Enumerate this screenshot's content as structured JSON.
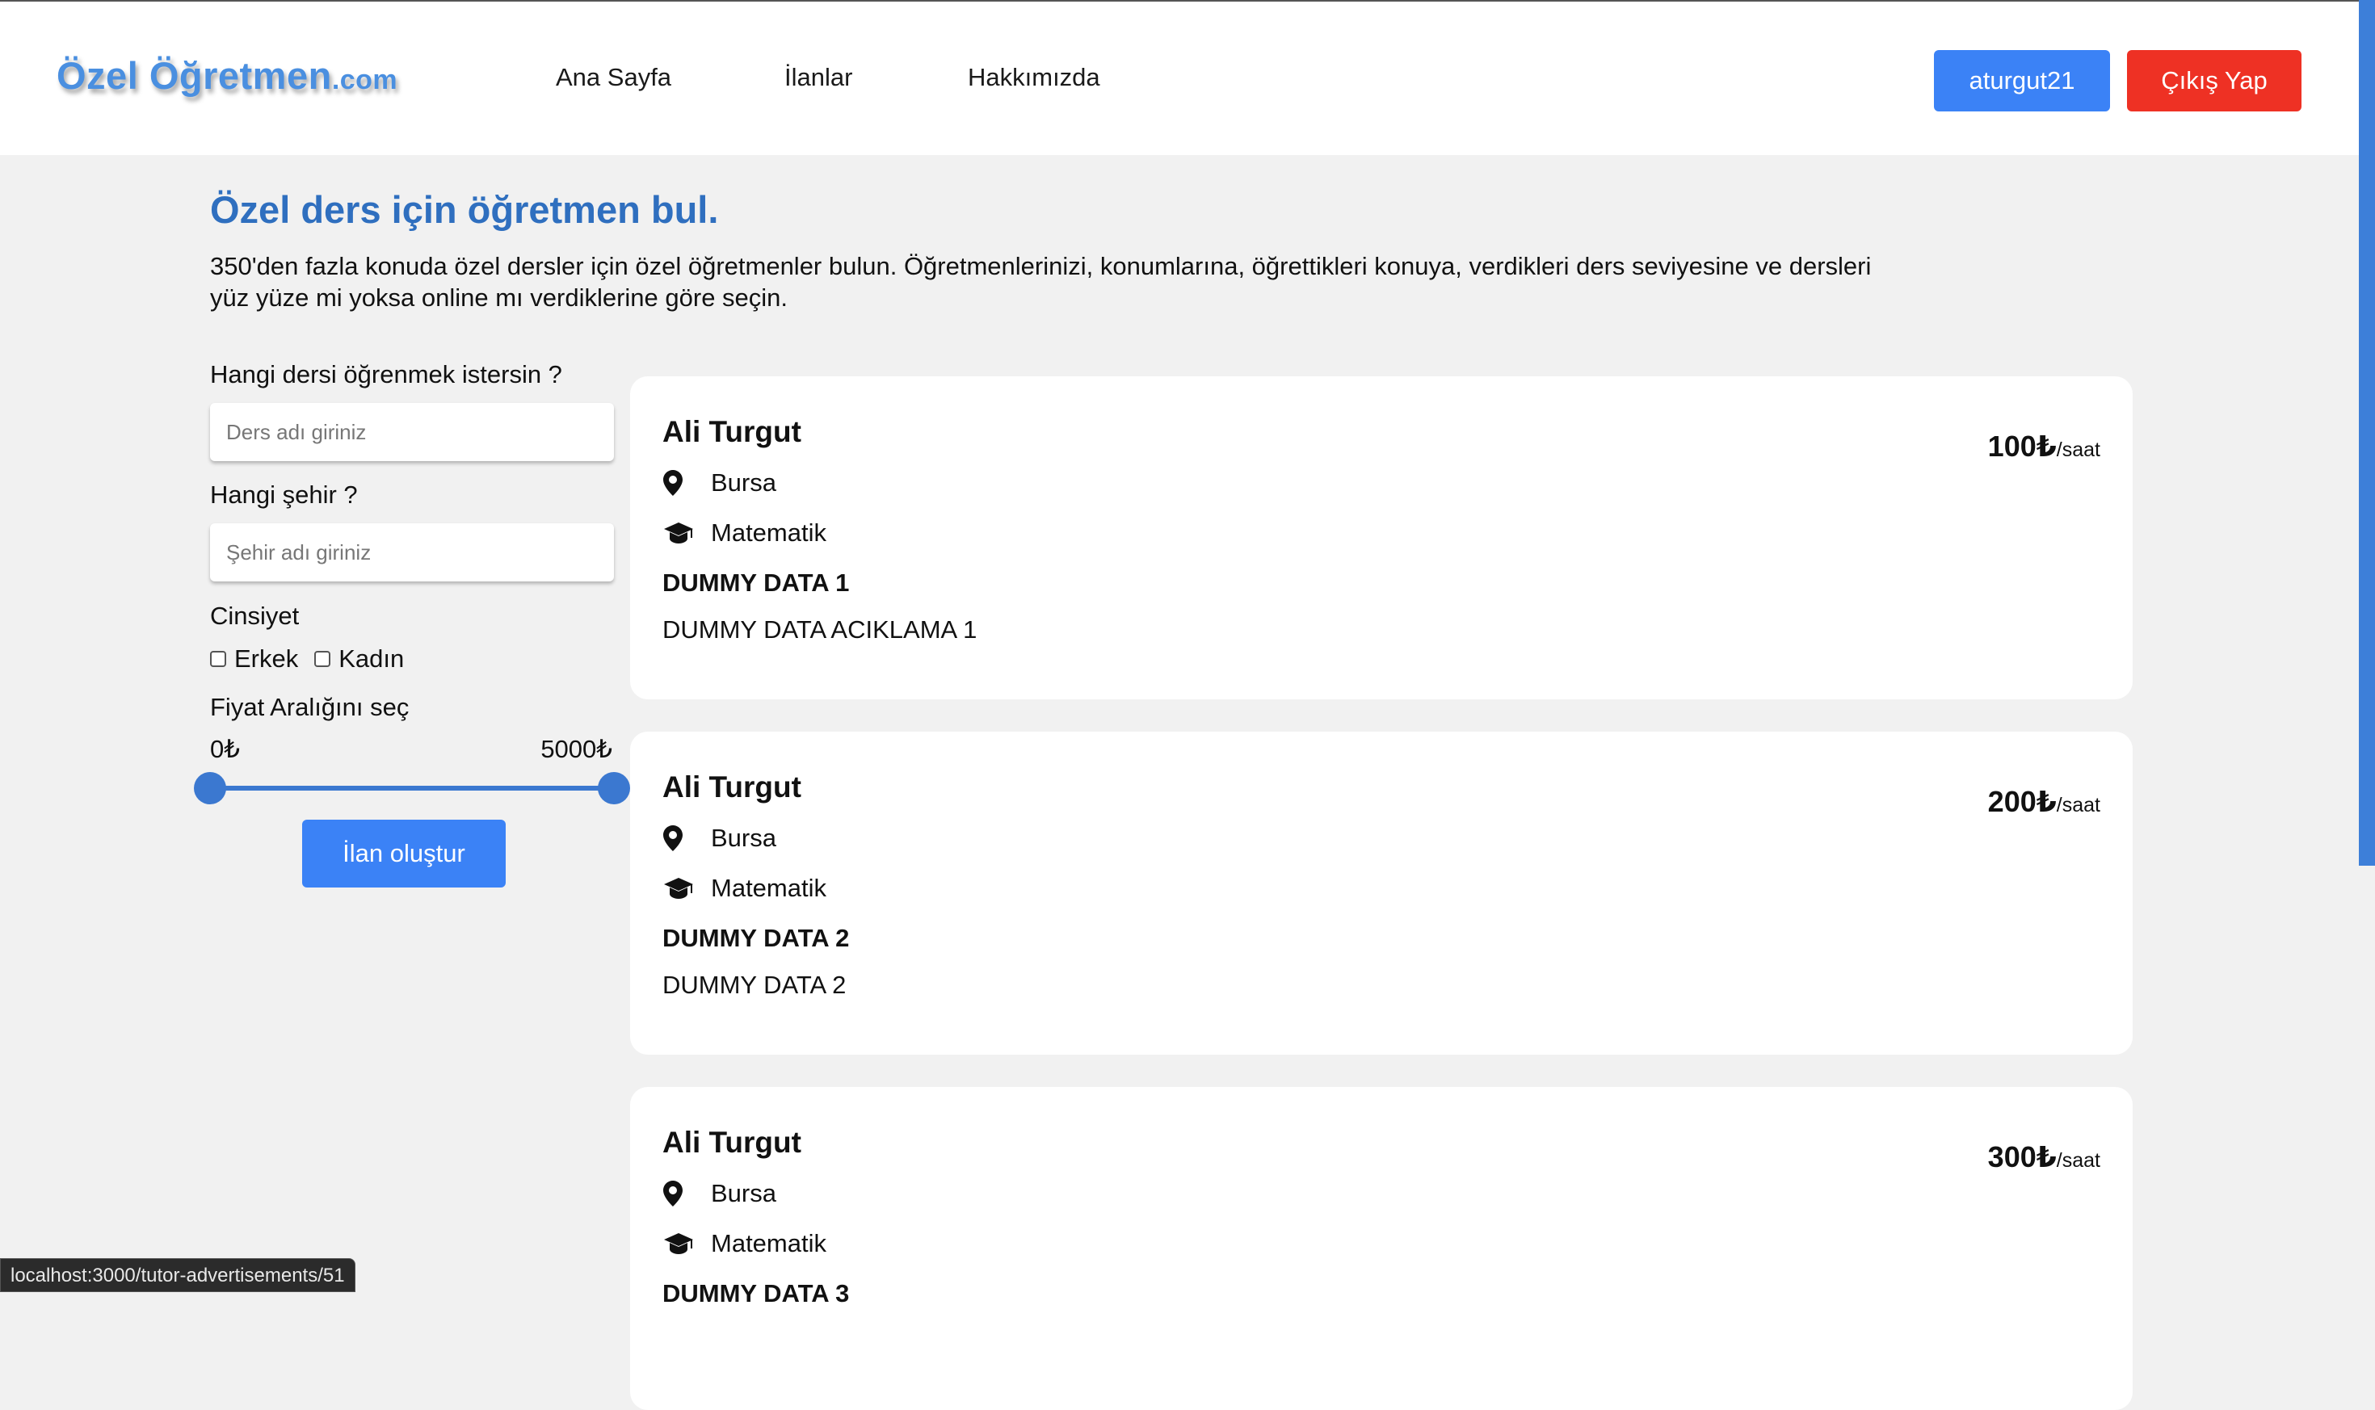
{
  "header": {
    "logo_main": "Özel Öğretmen",
    "logo_tld": ".com",
    "nav": [
      "Ana Sayfa",
      "İlanlar",
      "Hakkımızda"
    ],
    "user_button": "aturgut21",
    "logout_button": "Çıkış Yap"
  },
  "hero": {
    "title": "Özel ders için öğretmen bul.",
    "description": "350'den fazla konuda özel dersler için özel öğretmenler bulun. Öğretmenlerinizi, konumlarına, öğrettikleri konuya, verdikleri ders seviyesine ve dersleri yüz yüze mi yoksa online mı verdiklerine göre seçin."
  },
  "filters": {
    "lesson_label": "Hangi dersi öğrenmek istersin ?",
    "lesson_placeholder": "Ders adı giriniz",
    "city_label": "Hangi şehir ?",
    "city_placeholder": "Şehir adı giriniz",
    "gender_label": "Cinsiyet",
    "gender_options": [
      "Erkek",
      "Kadın"
    ],
    "price_label": "Fiyat Aralığını seç",
    "price_min": "0₺",
    "price_max": "5000₺",
    "create_button": "İlan oluştur"
  },
  "listings": [
    {
      "name": "Ali Turgut",
      "city": "Bursa",
      "subject": "Matematik",
      "title": "DUMMY DATA 1",
      "description": "DUMMY DATA ACIKLAMA 1",
      "price": "100₺",
      "unit": "/saat"
    },
    {
      "name": "Ali Turgut",
      "city": "Bursa",
      "subject": "Matematik",
      "title": "DUMMY DATA 2",
      "description": "DUMMY DATA 2",
      "price": "200₺",
      "unit": "/saat"
    },
    {
      "name": "Ali Turgut",
      "city": "Bursa",
      "subject": "Matematik",
      "title": "DUMMY DATA 3",
      "description": "",
      "price": "300₺",
      "unit": "/saat"
    }
  ],
  "status_bar": {
    "url": "localhost:3000/tutor-advertisements/51"
  },
  "colors": {
    "accent": "#3b82f6",
    "danger": "#ee3124",
    "heading": "#2f6fbf",
    "logo": "#4a8fe0"
  },
  "icons": {
    "location": "map-pin-icon",
    "subject": "graduation-cap-icon"
  }
}
